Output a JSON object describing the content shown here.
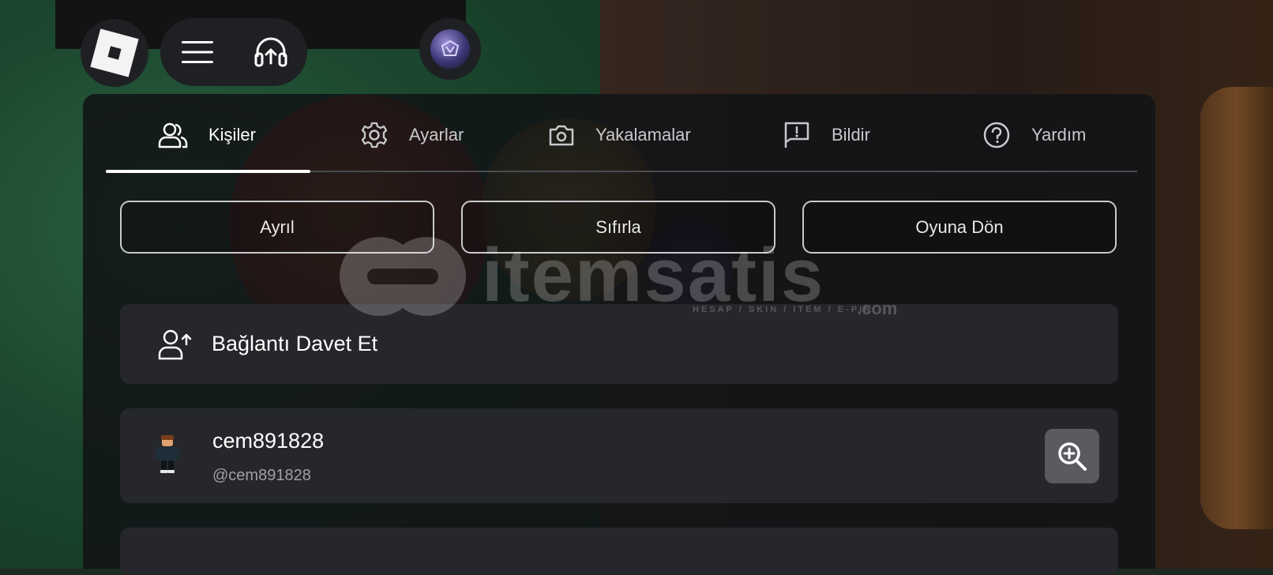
{
  "top_bar": {
    "logo_icon": "roblox-logo-icon",
    "menu_icon": "hamburger-menu-icon",
    "voice_icon": "headset-upload-icon",
    "avatar_icon": "avatar-badge-icon"
  },
  "tabs": [
    {
      "label": "Kişiler",
      "icon": "people-icon",
      "active": true
    },
    {
      "label": "Ayarlar",
      "icon": "gear-icon",
      "active": false
    },
    {
      "label": "Yakalamalar",
      "icon": "camera-icon",
      "active": false
    },
    {
      "label": "Bildir",
      "icon": "flag-icon",
      "active": false
    },
    {
      "label": "Yardım",
      "icon": "question-icon",
      "active": false
    }
  ],
  "actions": {
    "leave": "Ayrıl",
    "reset": "Sıfırla",
    "resume": "Oyuna Dön"
  },
  "invite": {
    "label": "Bağlantı Davet Et",
    "icon": "add-person-icon"
  },
  "players": [
    {
      "display_name": "cem891828",
      "username": "@cem891828",
      "inspect_icon": "zoom-in-icon"
    }
  ],
  "watermark": {
    "brand": "itemsatis",
    "tagline": "HESAP / SKIN / ITEM / E-PIN",
    "suffix": ".com"
  },
  "colors": {
    "panel": "#121316",
    "card": "#26272b",
    "active_tab": "#ffffff",
    "inactive_tab": "#c8c9cc",
    "button_border": "#c9cacc",
    "inspect_button": "#5a5b60"
  }
}
